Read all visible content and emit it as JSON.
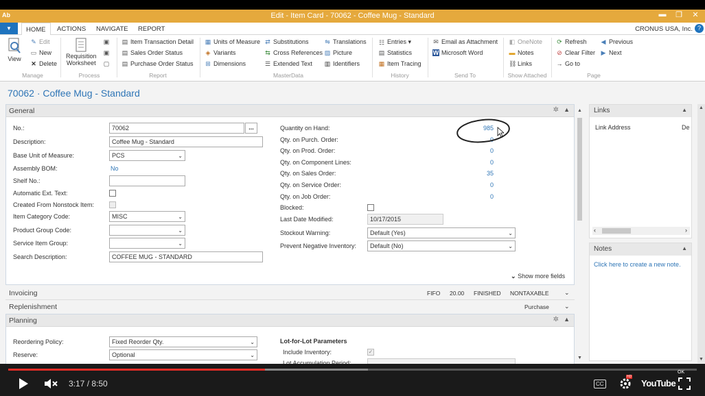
{
  "window": {
    "title": "Edit - Item Card - 70062 - Coffee Mug - Standard",
    "logo": "Ab",
    "min": "▬",
    "restore": "❐",
    "close": "✕"
  },
  "ribbon_tabs": [
    "HOME",
    "ACTIONS",
    "NAVIGATE",
    "REPORT"
  ],
  "company": "CRONUS USA, Inc.",
  "help": "?",
  "ribbon": {
    "manage": {
      "view": "View",
      "edit": "Edit",
      "new": "New",
      "delete": "Delete",
      "label": "Manage"
    },
    "process": {
      "req1": "Requisition",
      "req2": "Worksheet",
      "label": "Process"
    },
    "report": {
      "a": "Item Transaction Detail",
      "b": "Sales Order Status",
      "c": "Purchase Order Status",
      "label": "Report"
    },
    "masterdata": {
      "a": "Units of Measure",
      "b": "Variants",
      "c": "Dimensions",
      "d": "Substitutions",
      "e": "Cross References",
      "f": "Extended Text",
      "g": "Translations",
      "h": "Picture",
      "i": "Identifiers",
      "label": "MasterData"
    },
    "history": {
      "a": "Entries ▾",
      "b": "Statistics",
      "c": "Item Tracing",
      "label": "History"
    },
    "sendto": {
      "a": "Email as Attachment",
      "b": "Microsoft Word",
      "label": "Send To"
    },
    "attached": {
      "a": "OneNote",
      "b": "Notes",
      "c": "Links",
      "label": "Show Attached"
    },
    "page": {
      "a": "Refresh",
      "b": "Clear Filter",
      "c": "Go to",
      "d": "Previous",
      "e": "Next",
      "label": "Page"
    }
  },
  "page_title": "70062 · Coffee Mug - Standard",
  "general": {
    "title": "General",
    "no_label": "No.:",
    "no": "70062",
    "lookup": "...",
    "desc_label": "Description:",
    "desc": "Coffee Mug - Standard",
    "uom_label": "Base Unit of Measure:",
    "uom": "PCS",
    "bom_label": "Assembly BOM:",
    "bom": "No",
    "shelf_label": "Shelf No.:",
    "autoext_label": "Automatic Ext. Text:",
    "nonstock_label": "Created From Nonstock Item:",
    "cat_label": "Item Category Code:",
    "cat": "MISC",
    "pg_label": "Product Group Code:",
    "sig_label": "Service Item Group:",
    "search_label": "Search Description:",
    "search": "COFFEE MUG - STANDARD",
    "qoh_label": "Quantity on Hand:",
    "qoh": "985",
    "qpo_label": "Qty. on Purch. Order:",
    "qpo": "0",
    "qprod_label": "Qty. on Prod. Order:",
    "qprod": "0",
    "qcomp_label": "Qty. on Component Lines:",
    "qcomp": "0",
    "qso_label": "Qty. on Sales Order:",
    "qso": "35",
    "qsvc_label": "Qty. on Service Order:",
    "qsvc": "0",
    "qjob_label": "Qty. on Job Order:",
    "qjob": "0",
    "blocked_label": "Blocked:",
    "lastmod_label": "Last Date Modified:",
    "lastmod": "10/17/2015",
    "stockout_label": "Stockout Warning:",
    "stockout": "Default (Yes)",
    "preventneg_label": "Prevent Negative Inventory:",
    "preventneg": "Default (No)",
    "more": "Show more fields"
  },
  "invoicing": {
    "title": "Invoicing",
    "s1": "FIFO",
    "s2": "20.00",
    "s3": "FINISHED",
    "s4": "NONTAXABLE"
  },
  "replenishment": {
    "title": "Replenishment",
    "s1": "Purchase"
  },
  "planning": {
    "title": "Planning",
    "reorder_label": "Reordering Policy:",
    "reorder": "Fixed Reorder Qty.",
    "reserve_label": "Reserve:",
    "reserve": "Optional",
    "lfl_label": "Lot-for-Lot Parameters",
    "incinv_label": "Include Inventory:",
    "lotacc_label": "Lot Accumulation Period:"
  },
  "factbox": {
    "links_title": "Links",
    "link_addr": "Link Address",
    "link_de": "De",
    "notes_title": "Notes",
    "notes_link": "Click here to create a new note."
  },
  "player": {
    "time": "3:17 / 8:50",
    "cc": "CC",
    "yt": "YouTube",
    "hd": "HD",
    "ok": "OK",
    "progress": 0.3729
  }
}
